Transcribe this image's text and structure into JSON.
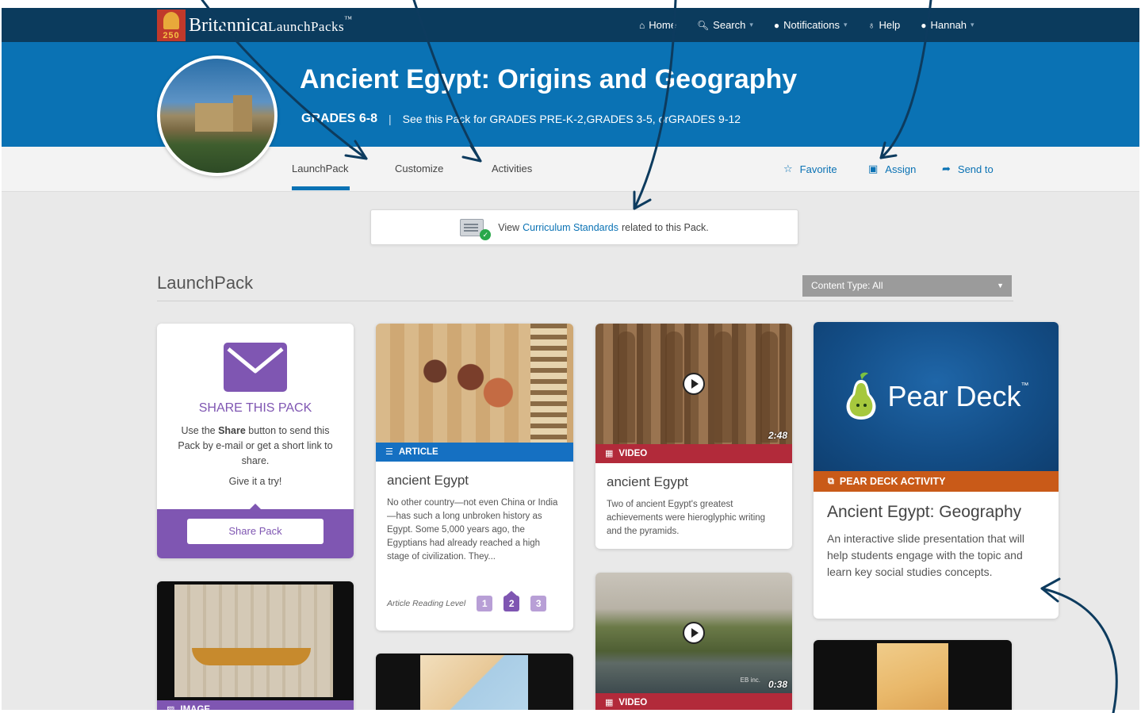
{
  "brand": {
    "logo_badge_num": "250",
    "name": "Britannica",
    "product": "LaunchPacks",
    "trademark": "™"
  },
  "nav": {
    "items": [
      {
        "label": "Home",
        "icon": "home-icon",
        "dropdown": false
      },
      {
        "label": "Search",
        "icon": "search-icon",
        "dropdown": true
      },
      {
        "label": "Notifications",
        "icon": "chat-bubble-icon",
        "dropdown": true
      },
      {
        "label": "Help",
        "icon": "lightbulb-icon",
        "dropdown": false
      },
      {
        "label": "Hannah",
        "icon": "user-icon",
        "dropdown": true
      }
    ]
  },
  "header": {
    "title": "Ancient Egypt: Origins and Geography",
    "grade": "GRADES 6-8",
    "separator": "|",
    "see_also_prefix": "See this Pack for",
    "see_also_links": [
      "GRADES PRE-K-2",
      "GRADES 3-5",
      "GRADES 9-12"
    ],
    "link_join_1": ", ",
    "link_join_2": ", or "
  },
  "tabs": [
    {
      "label": "LaunchPack",
      "active": true
    },
    {
      "label": "Customize",
      "active": false
    },
    {
      "label": "Activities",
      "active": false
    }
  ],
  "actions": [
    {
      "label": "Favorite",
      "icon": "star-icon"
    },
    {
      "label": "Assign",
      "icon": "calendar-icon"
    },
    {
      "label": "Send to",
      "icon": "share-arrow-icon"
    }
  ],
  "curriculum": {
    "prefix": "View",
    "link": "Curriculum Standards",
    "suffix": "related to this Pack."
  },
  "section": {
    "title": "LaunchPack",
    "content_type_select": "Content Type: All"
  },
  "share_card": {
    "title": "SHARE THIS PACK",
    "text_before": "Use the ",
    "text_bold": "Share",
    "text_after": " button to send this Pack by e-mail or get a short link to share.",
    "try_text": "Give it a try!",
    "button": "Share Pack"
  },
  "article_card": {
    "category": "ARTICLE",
    "title": "ancient Egypt",
    "text": "No other country—not even China or India—has such a long unbroken history as Egypt. Some 5,000 years ago, the Egyptians had already reached a high stage of civilization. They...",
    "reading_level_label": "Article Reading Level",
    "levels": [
      "1",
      "2",
      "3"
    ],
    "active_level": "2"
  },
  "video_card": {
    "category": "VIDEO",
    "duration": "2:48",
    "title": "ancient Egypt",
    "text": "Two of ancient Egypt's greatest achievements were hieroglyphic writing and the pyramids."
  },
  "pear_card": {
    "brand": "Pear Deck",
    "trademark": "™",
    "category": "PEAR DECK ACTIVITY",
    "title": "Ancient Egypt: Geography",
    "text": "An interactive slide presentation that will help students engage with the topic and learn key social studies concepts."
  },
  "papyrus_card": {
    "category": "IMAGE"
  },
  "video2_card": {
    "category": "VIDEO",
    "duration": "0:38",
    "watermark": "EB inc."
  },
  "colors": {
    "navbar": "#0b3b5d",
    "header": "#0a72b4",
    "purple": "#7f56b2",
    "article_blue": "#1570c2",
    "video_red": "#b22a3a",
    "pear_orange": "#c95a18",
    "annotation_arrow": "#0d3b5e"
  }
}
